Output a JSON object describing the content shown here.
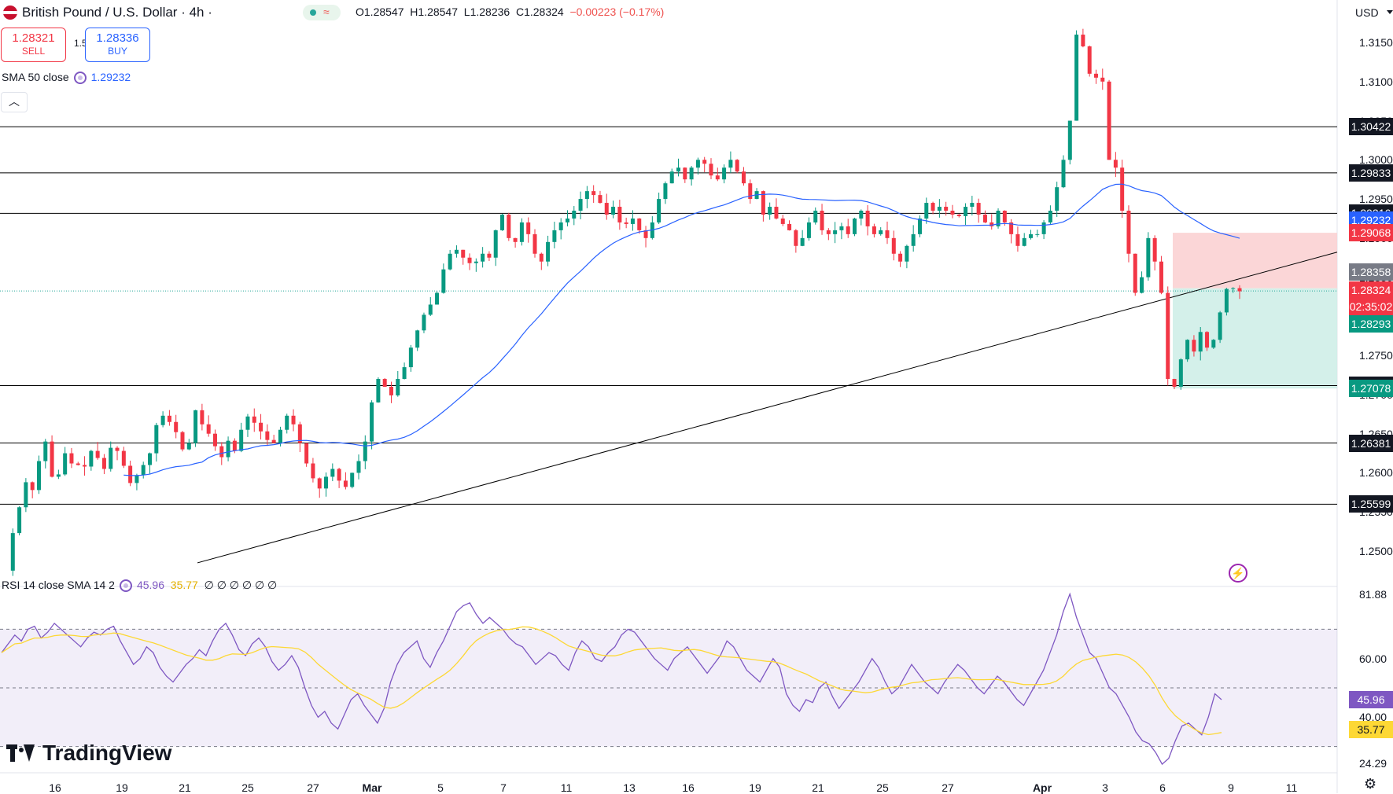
{
  "header": {
    "symbol": "British Pound / U.S. Dollar · 4h ·",
    "ohlc_o": "O1.28547",
    "ohlc_h": "H1.28547",
    "ohlc_l": "L1.28236",
    "ohlc_c": "C1.28324",
    "ohlc_change": "−0.00223 (−0.17%)",
    "sell_price": "1.28321",
    "sell_label": "SELL",
    "spread": "1.5",
    "buy_price": "1.28336",
    "buy_label": "BUY",
    "currency": "USD"
  },
  "sma_legend": {
    "label": "SMA 50 close",
    "value": "1.29232"
  },
  "rsi_legend": {
    "label": "RSI 14 close SMA 14 2",
    "rsi_value": "45.96",
    "sma_value": "35.77",
    "placeholders": "∅ ∅ ∅ ∅ ∅ ∅"
  },
  "branding": {
    "logo_text": "TradingView"
  },
  "colors": {
    "up": "#089981",
    "down": "#f23645",
    "sma": "#2962ff",
    "rsi": "#7e57c2",
    "rsi_sma": "#fdd835",
    "level": "#000000",
    "stop_zone": "#fbd1d3",
    "target_zone": "#cfeee8"
  },
  "chart_data": [
    {
      "type": "candlestick",
      "title": "British Pound / U.S. Dollar · 4h ·",
      "y_axis_ticks": [
        "1.31500",
        "1.31000",
        "1.30500",
        "1.30000",
        "1.29500",
        "1.29000",
        "1.28500",
        "1.28000",
        "1.27500",
        "1.27000",
        "1.26500",
        "1.26000",
        "1.25500",
        "1.25000"
      ],
      "ylim": [
        1.2475,
        1.3225
      ],
      "x_axis_ticks": [
        "16",
        "19",
        "21",
        "25",
        "27",
        "Mar",
        "5",
        "7",
        "11",
        "13",
        "16",
        "19",
        "21",
        "25",
        "27",
        "Apr",
        "3",
        "6",
        "9",
        "11"
      ],
      "horizontal_levels": [
        1.30422,
        1.29833,
        1.29316,
        1.27115,
        1.26381,
        1.25599
      ],
      "price_labels": [
        {
          "text": "1.30422",
          "kind": "level"
        },
        {
          "text": "1.29833",
          "kind": "level"
        },
        {
          "text": "1.29316",
          "kind": "level"
        },
        {
          "text": "1.29232",
          "kind": "sma"
        },
        {
          "text": "1.29068",
          "kind": "stop"
        },
        {
          "text": "1.28358",
          "kind": "entry"
        },
        {
          "text": "1.28324",
          "kind": "last"
        },
        {
          "text": "02:35:02",
          "kind": "countdown"
        },
        {
          "text": "1.28293",
          "kind": "target_top"
        },
        {
          "text": "1.27115",
          "kind": "level"
        },
        {
          "text": "1.27078",
          "kind": "target"
        },
        {
          "text": "1.26381",
          "kind": "level"
        },
        {
          "text": "1.25599",
          "kind": "level"
        }
      ],
      "series": [
        {
          "name": "SMA 50 close",
          "last": 1.29232
        }
      ],
      "trendline": {
        "from": 1.2485,
        "to": 1.2882
      },
      "position": {
        "entry": 1.28358,
        "stop": 1.29068,
        "target": 1.27078
      },
      "last_price": 1.28324,
      "close_path": [
        1.2475,
        1.2523,
        1.2556,
        1.2588,
        1.2578,
        1.2615,
        1.264,
        1.2595,
        1.2598,
        1.2625,
        1.2612,
        1.261,
        1.2608,
        1.2628,
        1.2619,
        1.2605,
        1.2632,
        1.2628,
        1.2609,
        1.2587,
        1.2597,
        1.261,
        1.2625,
        1.2661,
        1.2673,
        1.2665,
        1.2652,
        1.263,
        1.2638,
        1.268,
        1.2662,
        1.265,
        1.2634,
        1.262,
        1.2641,
        1.2628,
        1.2655,
        1.2672,
        1.2664,
        1.2653,
        1.2642,
        1.2638,
        1.2655,
        1.2673,
        1.2662,
        1.2638,
        1.2612,
        1.2593,
        1.258,
        1.2595,
        1.2605,
        1.259,
        1.2582,
        1.26,
        1.2615,
        1.264,
        1.269,
        1.272,
        1.271,
        1.2699,
        1.272,
        1.2735,
        1.276,
        1.2782,
        1.2802,
        1.2815,
        1.283,
        1.286,
        1.288,
        1.2885,
        1.2875,
        1.2868,
        1.287,
        1.288,
        1.2875,
        1.291,
        1.293,
        1.29,
        1.2895,
        1.292,
        1.2905,
        1.288,
        1.287,
        1.2895,
        1.291,
        1.292,
        1.2925,
        1.2935,
        1.295,
        1.296,
        1.2955,
        1.2945,
        1.293,
        1.294,
        1.292,
        1.2918,
        1.2925,
        1.291,
        1.29,
        1.292,
        1.295,
        1.297,
        1.2985,
        1.299,
        1.2975,
        1.299,
        1.3,
        1.2995,
        1.298,
        1.2975,
        1.299,
        1.3,
        1.2985,
        1.297,
        1.295,
        1.296,
        1.293,
        1.294,
        1.2925,
        1.2918,
        1.291,
        1.289,
        1.29,
        1.292,
        1.2935,
        1.291,
        1.2905,
        1.291,
        1.2915,
        1.2905,
        1.2925,
        1.2935,
        1.2915,
        1.2905,
        1.291,
        1.29,
        1.288,
        1.287,
        1.289,
        1.2905,
        1.2925,
        1.2945,
        1.2935,
        1.294,
        1.2935,
        1.293,
        1.2928,
        1.294,
        1.2945,
        1.293,
        1.292,
        1.2915,
        1.2935,
        1.292,
        1.2905,
        1.289,
        1.29,
        1.2905,
        1.2905,
        1.292,
        1.2935,
        1.2965,
        1.3,
        1.305,
        1.316,
        1.3145,
        1.311,
        1.3105,
        1.31,
        1.3,
        1.299,
        1.2935,
        1.288,
        1.283,
        1.285,
        1.29,
        1.287,
        1.283,
        1.272,
        1.271,
        1.2745,
        1.277,
        1.2755,
        1.278,
        1.276,
        1.277,
        1.2805,
        1.2835,
        1.2836,
        1.2832
      ]
    },
    {
      "type": "line",
      "title": "RSI 14 close SMA 14 2",
      "y_axis_ticks": [
        "81.88",
        "60.00",
        "40.00",
        "24.29"
      ],
      "ylim": [
        20,
        84
      ],
      "bands": [
        70,
        50,
        30
      ],
      "series": [
        {
          "name": "RSI",
          "last": 45.96,
          "values": [
            62,
            65,
            68,
            66,
            70,
            71,
            67,
            69,
            72,
            70,
            68,
            66,
            64,
            67,
            69,
            68,
            70,
            71,
            66,
            62,
            58,
            60,
            64,
            62,
            57,
            54,
            52,
            55,
            58,
            60,
            63,
            61,
            66,
            70,
            72,
            68,
            63,
            61,
            65,
            67,
            64,
            59,
            56,
            58,
            61,
            57,
            50,
            44,
            40,
            42,
            38,
            36,
            41,
            46,
            48,
            44,
            41,
            38,
            43,
            52,
            58,
            62,
            64,
            66,
            60,
            57,
            62,
            66,
            71,
            76,
            78,
            79,
            75,
            72,
            74,
            72,
            70,
            67,
            65,
            64,
            61,
            58,
            60,
            62,
            61,
            58,
            56,
            62,
            66,
            64,
            60,
            59,
            62,
            64,
            68,
            70,
            69,
            66,
            63,
            60,
            58,
            56,
            60,
            62,
            64,
            61,
            58,
            55,
            58,
            61,
            66,
            64,
            60,
            56,
            54,
            52,
            56,
            60,
            57,
            48,
            44,
            42,
            46,
            45,
            50,
            52,
            47,
            43,
            46,
            49,
            52,
            56,
            60,
            57,
            52,
            48,
            50,
            54,
            58,
            55,
            52,
            50,
            48,
            52,
            55,
            58,
            56,
            53,
            50,
            48,
            51,
            54,
            52,
            49,
            46,
            44,
            48,
            52,
            56,
            62,
            68,
            76,
            82,
            74,
            68,
            62,
            60,
            55,
            50,
            48,
            44,
            40,
            35,
            32,
            31,
            28,
            24,
            26,
            32,
            37,
            38,
            36,
            34,
            40,
            48,
            46
          ]
        },
        {
          "name": "RSI SMA",
          "last": 35.77
        }
      ]
    }
  ]
}
